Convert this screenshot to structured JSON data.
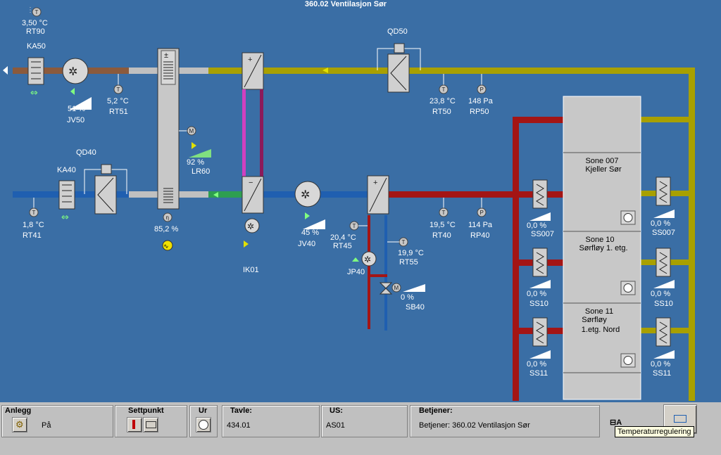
{
  "title": "360.02 Ventilasjon Sør",
  "colors": {
    "background": "#3a6ea5",
    "exhaust_duct": "#8b5a3c",
    "return_duct": "#a8a000",
    "supply_cold_duct": "#1f5fb0",
    "supply_hot_duct": "#a31515",
    "heater_coil": "#d040c0",
    "bar": "#c0c0c0"
  },
  "components": {
    "ka50": "KA50",
    "rt90": {
      "value": "3,50 °C",
      "tag": "RT90"
    },
    "jv50": {
      "value": "51 %",
      "tag": "JV50"
    },
    "rt51": {
      "value": "5,2 °C",
      "tag": "RT51"
    },
    "qd50": "QD50",
    "rt50": {
      "value": "23,8 °C",
      "tag": "RT50"
    },
    "rp50": {
      "value": "148 Pa",
      "tag": "RP50"
    },
    "qd40": "QD40",
    "ka40": "KA40",
    "rt41": {
      "value": "1,8 °C",
      "tag": "RT41"
    },
    "lr60": {
      "value": "92 %",
      "tag": "LR60"
    },
    "recovery": {
      "value": "85,2 %"
    },
    "ik01": "IK01",
    "jv40": {
      "value": "45 %",
      "tag": "JV40"
    },
    "rt45": {
      "value": "20,4 °C",
      "tag": "RT45"
    },
    "jp40": "JP40",
    "rt55": {
      "value": "19,9 °C",
      "tag": "RT55"
    },
    "sb40": {
      "value": "0 %",
      "tag": "SB40"
    },
    "rt40": {
      "value": "19,5 °C",
      "tag": "RT40"
    },
    "rp40": {
      "value": "114 Pa",
      "tag": "RP40"
    }
  },
  "zones": [
    {
      "name": "Sone 007",
      "sub": "Kjeller Sør",
      "sub2": "",
      "left_value": "0,0 %",
      "left_tag": "SS007",
      "right_value": "0,0 %",
      "right_tag": "SS007"
    },
    {
      "name": "Sone 10",
      "sub": "Sørfløy 1. etg.",
      "sub2": "",
      "left_value": "0,0 %",
      "left_tag": "SS10",
      "right_value": "0,0 %",
      "right_tag": "SS10"
    },
    {
      "name": "Sone 11",
      "sub": "Sørfløy",
      "sub2": "1.etg. Nord",
      "left_value": "0,0 %",
      "left_tag": "SS11",
      "right_value": "0,0 %",
      "right_tag": "SS11"
    }
  ],
  "bottom": {
    "anlegg": {
      "title": "Anlegg",
      "value": "På"
    },
    "settpunkt": {
      "title": "Settpunkt"
    },
    "ur": {
      "title": "Ur"
    },
    "tavle": {
      "title": "Tavle:",
      "value": "434.01"
    },
    "us": {
      "title": "US:",
      "value": "AS01"
    },
    "betjener": {
      "title": "Betjener:",
      "value": "Betjener: 360.02 Ventilasjon Sør"
    },
    "lock": "A",
    "tooltip": "Temperaturregulering"
  }
}
